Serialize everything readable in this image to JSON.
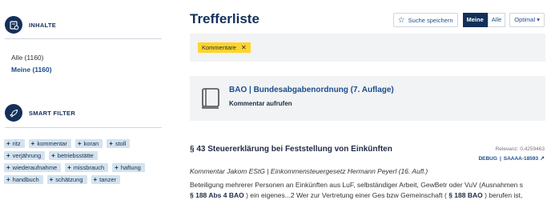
{
  "sidebar": {
    "contents": {
      "title": "INHALTE",
      "icon": "scale-document-icon",
      "all_label": "Alle (1160)",
      "mine_label": "Meine (1160)"
    },
    "smart_filter": {
      "title": "SMART FILTER",
      "icon": "rocket-icon",
      "tags": [
        [
          "ritz",
          "kommentar",
          "koran",
          "stoll"
        ],
        [
          "verjährung",
          "betriebsstätte"
        ],
        [
          "wiederaufnahme",
          "missbrauch",
          "haftung"
        ],
        [
          "handbuch",
          "schätzung",
          "tanzer"
        ]
      ]
    }
  },
  "header": {
    "title": "Trefferliste",
    "save_search": "Suche speichern",
    "scope_mine": "Meine",
    "scope_all": "Alle",
    "sort_label": "Optimal ▾"
  },
  "active_filter": {
    "label": "Kommentare",
    "remove": "✕"
  },
  "book": {
    "title": "BAO | Bundesabgabenordnung (7. Auflage)",
    "link": "Kommentar aufrufen"
  },
  "result": {
    "title": "§ 43 Steuererklärung bei Feststellung von Einkünften",
    "relevance": "Relevanz: 0,4259463",
    "debug": "DEBUG",
    "doc_id": "SAAAA-18593",
    "source": "Kommentar Jakom EStG | Einkommensteuergesetz Hermann Peyerl (16. Aufl.)",
    "snippet_line1": "Beteiligung mehrerer Personen an Einkünften aus LuF, selbständiger Arbeit, GewBetr oder VuV (Ausnahmen s",
    "snippet_bold_a": "§ 188 Abs 4 BAO",
    "snippet_mid": ") ein eigenes...2 Wer zur Vertretung einer Ges bzw Gemeinschaft (",
    "snippet_bold_b": "§ 188 BAO",
    "snippet_end": ") berufen ist,"
  },
  "colors": {
    "navy": "#13305a",
    "link_blue": "#1b4d8c",
    "tag_bg": "#d2e3ef",
    "chip_yellow": "#ffd42a",
    "panel_bg": "#f1f3f5"
  }
}
